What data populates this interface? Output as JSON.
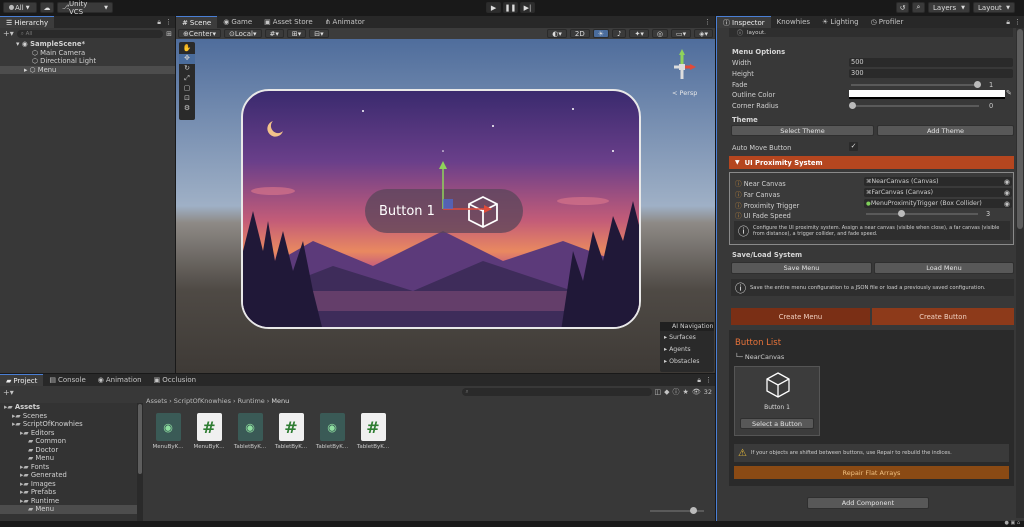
{
  "toolbar": {
    "all": "All",
    "cloud": "cloud-icon",
    "vcs": "Unity VCS",
    "layers": "Layers",
    "layout": "Layout"
  },
  "hierarchy": {
    "tab": "Hierarchy",
    "search": "All",
    "scene": "SampleScene*",
    "items": [
      "Main Camera",
      "Directional Light",
      "Menu"
    ]
  },
  "scene_tabs": {
    "scene": "Scene",
    "game": "Game",
    "asset_store": "Asset Store",
    "animator": "Animator"
  },
  "scene_toolbar": {
    "pivot": "Center",
    "space": "Local",
    "mode2d": "2D",
    "persp": "< Persp"
  },
  "scene_view": {
    "button_label": "Button 1",
    "overlay_title": "AI Navigation",
    "overlay_items": [
      "Surfaces",
      "Agents",
      "Obstacles"
    ]
  },
  "inspector": {
    "tabs": [
      "Inspector",
      "Knowhies",
      "Lighting",
      "Profiler"
    ],
    "top_text": "layout.",
    "menu_options_title": "Menu Options",
    "width_label": "Width",
    "width_value": "500",
    "height_label": "Height",
    "height_value": "300",
    "fade_label": "Fade",
    "fade_value": "1",
    "outline_label": "Outline Color",
    "radius_label": "Corner Radius",
    "radius_value": "0",
    "theme_title": "Theme",
    "select_theme": "Select Theme",
    "add_theme": "Add Theme",
    "auto_move_label": "Auto Move Button",
    "proximity_title": "UI Proximity System",
    "near_label": "Near Canvas",
    "near_value": "NearCanvas (Canvas)",
    "far_label": "Far Canvas",
    "far_value": "FarCanvas (Canvas)",
    "trigger_label": "Proximity Trigger",
    "trigger_value": "MenuProximityTrigger (Box Collider)",
    "fade_speed_label": "UI Fade Speed",
    "fade_speed_value": "3",
    "proximity_info": "Configure the UI proximity system. Assign a near canvas (visible when close), a far canvas (visible from distance), a trigger collider, and fade speed.",
    "saveload_title": "Save/Load System",
    "save_menu": "Save Menu",
    "load_menu": "Load Menu",
    "saveload_info": "Save the entire menu configuration to a JSON file or load a previously saved configuration.",
    "create_menu": "Create Menu",
    "create_button": "Create Button",
    "button_list_title": "Button List",
    "near_canvas_node": "NearCanvas",
    "card_label": "Button 1",
    "select_button": "Select a Button",
    "warning_text": "If your objects are shifted between buttons, use Repair to rebuild the indices.",
    "repair": "Repair Flat Arrays",
    "add_component": "Add Component"
  },
  "bottom": {
    "tabs": [
      "Project",
      "Console",
      "Animation",
      "Occlusion"
    ],
    "count": "32",
    "breadcrumb": [
      "Assets",
      "ScriptOfKnowhies",
      "Runtime",
      "Menu"
    ],
    "tree": [
      {
        "label": "Assets",
        "indent": 0,
        "bold": true
      },
      {
        "label": "Scenes",
        "indent": 1
      },
      {
        "label": "ScriptOfKnowhies",
        "indent": 1
      },
      {
        "label": "Editors",
        "indent": 2
      },
      {
        "label": "Common",
        "indent": 3
      },
      {
        "label": "Doctor",
        "indent": 3
      },
      {
        "label": "Menu",
        "indent": 3
      },
      {
        "label": "Fonts",
        "indent": 2
      },
      {
        "label": "Generated",
        "indent": 2
      },
      {
        "label": "Images",
        "indent": 2
      },
      {
        "label": "Prefabs",
        "indent": 2
      },
      {
        "label": "Runtime",
        "indent": 2
      },
      {
        "label": "Menu",
        "indent": 3
      }
    ],
    "assets": [
      {
        "label": "MenuByK...",
        "type": "uitk"
      },
      {
        "label": "MenuByK...",
        "type": "script"
      },
      {
        "label": "TabletByK...",
        "type": "uitk"
      },
      {
        "label": "TabletByK...",
        "type": "script"
      },
      {
        "label": "TabletByK...",
        "type": "uitk"
      },
      {
        "label": "TabletByK...",
        "type": "script"
      }
    ]
  },
  "colors": {
    "accent": "#4a7fd5",
    "orange": "#b5461f",
    "orange_dark": "#7a2f15"
  }
}
